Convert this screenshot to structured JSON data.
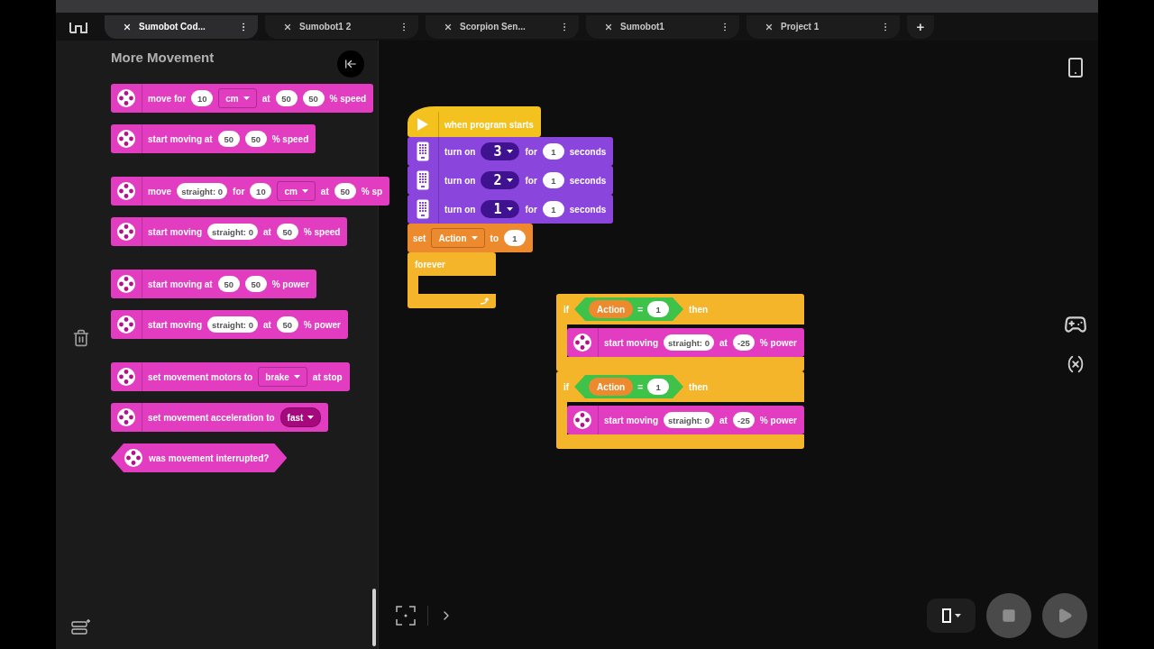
{
  "tabs": [
    {
      "label": "Sumobot Cod...",
      "selected": true
    },
    {
      "label": "Sumobot1 2",
      "selected": false
    },
    {
      "label": "Scorpion Sen...",
      "selected": false
    },
    {
      "label": "Sumobot1",
      "selected": false
    },
    {
      "label": "Project 1",
      "selected": false
    }
  ],
  "tab_add": "+",
  "palette": {
    "title": "More Movement",
    "groups": [
      {
        "blocks": [
          {
            "kind": "motor",
            "color": "#e23cc0",
            "parts": [
              {
                "kind": "text",
                "text": "move for"
              },
              {
                "kind": "number",
                "text": "10"
              },
              {
                "kind": "dropdown",
                "text": "cm"
              },
              {
                "kind": "text",
                "text": "at"
              },
              {
                "kind": "number",
                "text": "50"
              },
              {
                "kind": "number",
                "text": "50"
              },
              {
                "kind": "text",
                "text": "% speed"
              }
            ]
          },
          {
            "kind": "motor",
            "color": "#e23cc0",
            "parts": [
              {
                "kind": "text",
                "text": "start moving at"
              },
              {
                "kind": "number",
                "text": "50"
              },
              {
                "kind": "number",
                "text": "50"
              },
              {
                "kind": "text",
                "text": "% speed"
              }
            ]
          }
        ]
      },
      {
        "blocks": [
          {
            "kind": "motor",
            "color": "#e23cc0",
            "parts": [
              {
                "kind": "text",
                "text": "move"
              },
              {
                "kind": "number",
                "text": "straight: 0"
              },
              {
                "kind": "text",
                "text": "for"
              },
              {
                "kind": "number",
                "text": "10"
              },
              {
                "kind": "dropdown",
                "text": "cm"
              },
              {
                "kind": "text",
                "text": "at"
              },
              {
                "kind": "number",
                "text": "50"
              },
              {
                "kind": "text",
                "text": "% sp"
              }
            ]
          },
          {
            "kind": "motor",
            "color": "#e23cc0",
            "parts": [
              {
                "kind": "text",
                "text": "start moving"
              },
              {
                "kind": "number",
                "text": "straight: 0"
              },
              {
                "kind": "text",
                "text": "at"
              },
              {
                "kind": "number",
                "text": "50"
              },
              {
                "kind": "text",
                "text": "% speed"
              }
            ]
          }
        ]
      },
      {
        "blocks": [
          {
            "kind": "motor",
            "color": "#e23cc0",
            "parts": [
              {
                "kind": "text",
                "text": "start moving at"
              },
              {
                "kind": "number",
                "text": "50"
              },
              {
                "kind": "number",
                "text": "50"
              },
              {
                "kind": "text",
                "text": "% power"
              }
            ]
          },
          {
            "kind": "motor",
            "color": "#e23cc0",
            "parts": [
              {
                "kind": "text",
                "text": "start moving"
              },
              {
                "kind": "number",
                "text": "straight: 0"
              },
              {
                "kind": "text",
                "text": "at"
              },
              {
                "kind": "number",
                "text": "50"
              },
              {
                "kind": "text",
                "text": "% power"
              }
            ]
          }
        ]
      },
      {
        "blocks": [
          {
            "kind": "motor",
            "color": "#e23cc0",
            "parts": [
              {
                "kind": "text",
                "text": "set movement motors to"
              },
              {
                "kind": "dropdown",
                "text": "brake"
              },
              {
                "kind": "text",
                "text": "at stop"
              }
            ]
          },
          {
            "kind": "motor",
            "color": "#e23cc0",
            "parts": [
              {
                "kind": "text",
                "text": "set movement acceleration to"
              },
              {
                "kind": "menu",
                "text": "fast"
              }
            ]
          },
          {
            "kind": "motor_boolean",
            "color": "#e23cc0",
            "parts": [
              {
                "kind": "text",
                "text": "was movement interrupted?"
              }
            ]
          }
        ]
      }
    ]
  },
  "canvas": {
    "scripts": [
      {
        "blocks": [
          {
            "kind": "hat",
            "color": "#f4c21e",
            "parts": [
              {
                "kind": "text",
                "text": "when program starts"
              }
            ]
          },
          {
            "kind": "hub",
            "color": "#8a45dd",
            "parts": [
              {
                "kind": "text",
                "text": "turn on"
              },
              {
                "kind": "matrix",
                "text": "3"
              },
              {
                "kind": "text",
                "text": "for"
              },
              {
                "kind": "number",
                "text": "1"
              },
              {
                "kind": "text",
                "text": "seconds"
              }
            ]
          },
          {
            "kind": "hub",
            "color": "#8a45dd",
            "parts": [
              {
                "kind": "text",
                "text": "turn on"
              },
              {
                "kind": "matrix",
                "text": "2"
              },
              {
                "kind": "text",
                "text": "for"
              },
              {
                "kind": "number",
                "text": "1"
              },
              {
                "kind": "text",
                "text": "seconds"
              }
            ]
          },
          {
            "kind": "hub",
            "color": "#8a45dd",
            "parts": [
              {
                "kind": "text",
                "text": "turn on"
              },
              {
                "kind": "matrix",
                "text": "1"
              },
              {
                "kind": "text",
                "text": "for"
              },
              {
                "kind": "number",
                "text": "1"
              },
              {
                "kind": "text",
                "text": "seconds"
              }
            ]
          },
          {
            "kind": "plain",
            "color": "#ee8a2e",
            "parts": [
              {
                "kind": "text",
                "text": "set"
              },
              {
                "kind": "vardrop",
                "text": "Action"
              },
              {
                "kind": "text",
                "text": "to"
              },
              {
                "kind": "number",
                "text": "1"
              }
            ]
          },
          {
            "kind": "loop",
            "color": "#f4b52a",
            "parts": [
              {
                "kind": "text",
                "text": "forever"
              }
            ]
          }
        ]
      },
      {
        "blocks": [
          {
            "kind": "c",
            "color": "#f4b52a",
            "parts": [
              {
                "kind": "text",
                "text": "if"
              },
              {
                "kind": "condition",
                "parts": [
                  {
                    "kind": "variable",
                    "text": "Action"
                  },
                  {
                    "kind": "text",
                    "text": "="
                  },
                  {
                    "kind": "number",
                    "text": "1"
                  }
                ]
              },
              {
                "kind": "text",
                "text": "then"
              }
            ],
            "children": [
              {
                "kind": "motor",
                "color": "#e23cc0",
                "parts": [
                  {
                    "kind": "text",
                    "text": "start moving"
                  },
                  {
                    "kind": "number",
                    "text": "straight: 0"
                  },
                  {
                    "kind": "text",
                    "text": "at"
                  },
                  {
                    "kind": "number",
                    "text": "-25"
                  },
                  {
                    "kind": "text",
                    "text": "% power"
                  }
                ]
              }
            ]
          },
          {
            "kind": "c",
            "color": "#f4b52a",
            "parts": [
              {
                "kind": "text",
                "text": "if"
              },
              {
                "kind": "condition",
                "parts": [
                  {
                    "kind": "variable",
                    "text": "Action"
                  },
                  {
                    "kind": "text",
                    "text": "="
                  },
                  {
                    "kind": "number",
                    "text": "1"
                  }
                ]
              },
              {
                "kind": "text",
                "text": "then"
              }
            ],
            "children": [
              {
                "kind": "motor",
                "color": "#e23cc0",
                "parts": [
                  {
                    "kind": "text",
                    "text": "start moving"
                  },
                  {
                    "kind": "number",
                    "text": "straight: 0"
                  },
                  {
                    "kind": "text",
                    "text": "at"
                  },
                  {
                    "kind": "number",
                    "text": "-25"
                  },
                  {
                    "kind": "text",
                    "text": "% power"
                  }
                ]
              }
            ]
          }
        ]
      }
    ]
  }
}
